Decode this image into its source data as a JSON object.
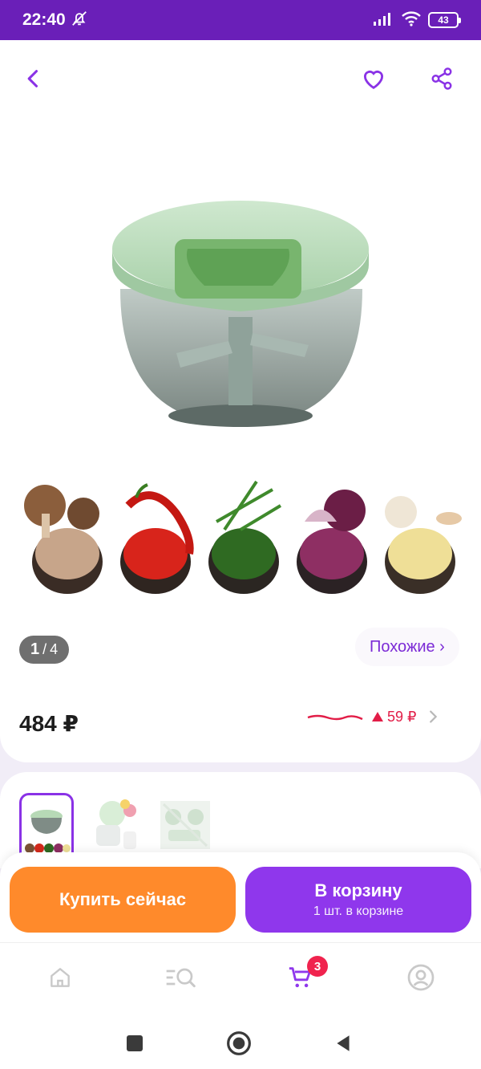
{
  "status_bar": {
    "time": "22:40",
    "battery": "43"
  },
  "product": {
    "image_position": {
      "current": "1",
      "separator": "/",
      "total": "4"
    },
    "similar_label": "Похожие ›",
    "price": "484 ₽",
    "price_change": "59 ₽"
  },
  "actions": {
    "buy_now": "Купить сейчас",
    "add_to_cart": "В корзину",
    "in_cart_note": "1 шт. в корзине"
  },
  "tab_bar": {
    "cart_badge": "3"
  },
  "colors": {
    "accent": "#8f37ec",
    "status_bar": "#6a1fb8",
    "buy_now": "#ff8a2b",
    "price_up": "#e21d47"
  }
}
